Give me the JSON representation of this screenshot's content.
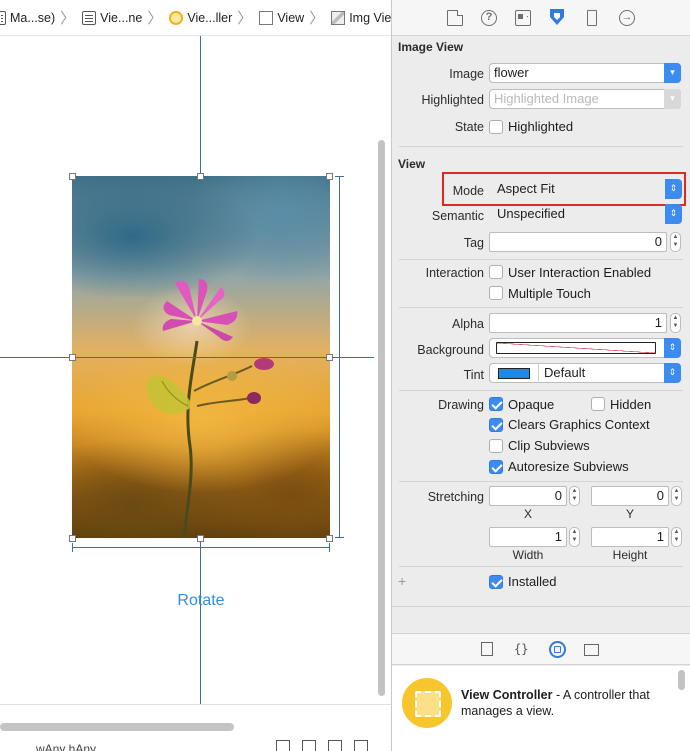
{
  "breadcrumb": [
    {
      "label": "Ma...se)",
      "icon": "storyboard-icon"
    },
    {
      "label": "Vie...ne",
      "icon": "scene-icon"
    },
    {
      "label": "Vie...ller",
      "icon": "view-controller-icon"
    },
    {
      "label": "View",
      "icon": "view-icon"
    },
    {
      "label": "Img View",
      "icon": "image-view-icon"
    }
  ],
  "canvas": {
    "rotate_label": "Rotate",
    "size_class_label": "wAny hAny"
  },
  "inspector": {
    "tabs": [
      "file-inspector",
      "quick-help",
      "identity-inspector",
      "attributes-inspector",
      "size-inspector",
      "connections-inspector"
    ],
    "active_tab": "attributes-inspector",
    "image_view": {
      "title": "Image View",
      "image_label": "Image",
      "image_value": "flower",
      "highlighted_label": "Highlighted",
      "highlighted_placeholder": "Highlighted Image",
      "state_label": "State",
      "state_checkbox_label": "Highlighted",
      "state_checked": false
    },
    "view": {
      "title": "View",
      "mode_label": "Mode",
      "mode_value": "Aspect Fit",
      "semantic_label": "Semantic",
      "semantic_value": "Unspecified",
      "tag_label": "Tag",
      "tag_value": "0",
      "interaction_label": "Interaction",
      "user_interaction_label": "User Interaction Enabled",
      "multiple_touch_label": "Multiple Touch",
      "alpha_label": "Alpha",
      "alpha_value": "1",
      "background_label": "Background",
      "tint_label": "Tint",
      "tint_value": "Default",
      "tint_color": "#1f87e6",
      "drawing_label": "Drawing",
      "opaque_label": "Opaque",
      "hidden_label": "Hidden",
      "clears_graphics_label": "Clears Graphics Context",
      "clip_subviews_label": "Clip Subviews",
      "autoresize_label": "Autoresize Subviews",
      "stretching_label": "Stretching",
      "stretch_x": "0",
      "stretch_y": "0",
      "stretch_width": "1",
      "stretch_height": "1",
      "x_label": "X",
      "y_label": "Y",
      "width_label": "Width",
      "height_label": "Height",
      "installed_plus": "+",
      "installed_label": "Installed"
    }
  },
  "library": {
    "item_title": "View Controller",
    "item_desc": " - A controller that manages a view."
  },
  "colors": {
    "accent": "#3b8bf2",
    "highlight_border": "#e0281b",
    "link": "#2d8fe0"
  }
}
